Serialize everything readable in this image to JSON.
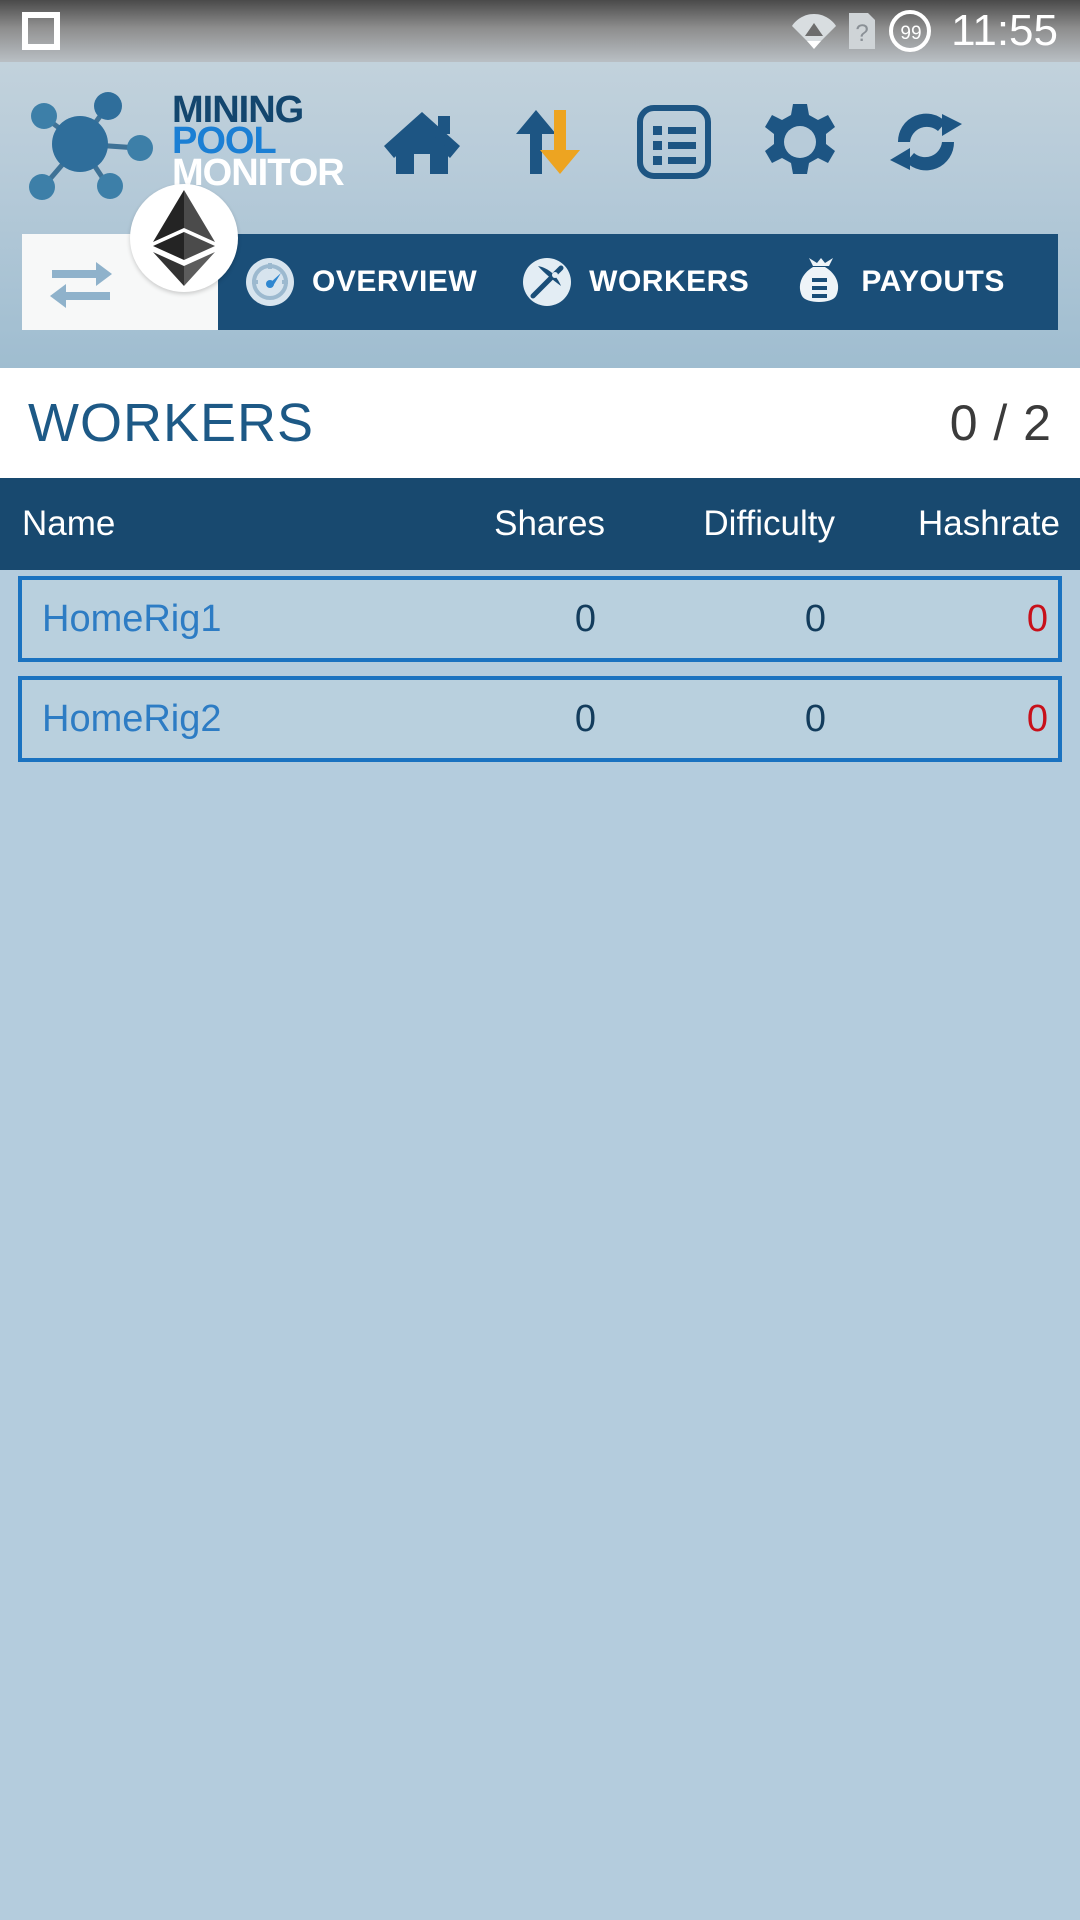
{
  "status_bar": {
    "recents_icon": "square-icon",
    "wifi_icon": "wifi-icon",
    "sim_icon": "sim-question-icon",
    "battery_icon": "battery-icon",
    "battery_level": "99",
    "time": "11:55"
  },
  "header": {
    "logo": {
      "mark": "network-nodes-icon",
      "line1": "MINING",
      "line2": "POOL",
      "line3": "MONITOR"
    },
    "toolbar": [
      {
        "name": "home-icon",
        "label": "Home"
      },
      {
        "name": "transfer-arrows-icon",
        "label": "Transfers"
      },
      {
        "name": "list-document-icon",
        "label": "List"
      },
      {
        "name": "gear-icon",
        "label": "Settings"
      },
      {
        "name": "refresh-icon",
        "label": "Refresh"
      }
    ]
  },
  "tabbar": {
    "swap_icon": "swap-arrows-icon",
    "coin_icon": "ethereum-icon",
    "tabs": [
      {
        "icon": "speedometer-icon",
        "label": "OVERVIEW",
        "active": false
      },
      {
        "icon": "pickaxe-icon",
        "label": "WORKERS",
        "active": true
      },
      {
        "icon": "money-bag-icon",
        "label": "PAYOUTS",
        "active": false
      }
    ]
  },
  "page": {
    "title": "WORKERS",
    "count": "0 / 2"
  },
  "table": {
    "columns": [
      "Name",
      "Shares",
      "Difficulty",
      "Hashrate"
    ],
    "rows": [
      {
        "name": "HomeRig1",
        "shares": "0",
        "difficulty": "0",
        "hashrate": "0"
      },
      {
        "name": "HomeRig2",
        "shares": "0",
        "difficulty": "0",
        "hashrate": "0"
      }
    ]
  },
  "colors": {
    "header_blue": "#1a4e78",
    "table_header": "#18496f",
    "row_border": "#1a72c0",
    "row_bg": "#b9d0de",
    "page_bg": "#b4ccdd",
    "name_link": "#2d7cc4",
    "value_dark": "#133c5c",
    "hashrate_red": "#c8101a",
    "brand_blue": "#1b7fd4",
    "accent_orange": "#eda421"
  }
}
